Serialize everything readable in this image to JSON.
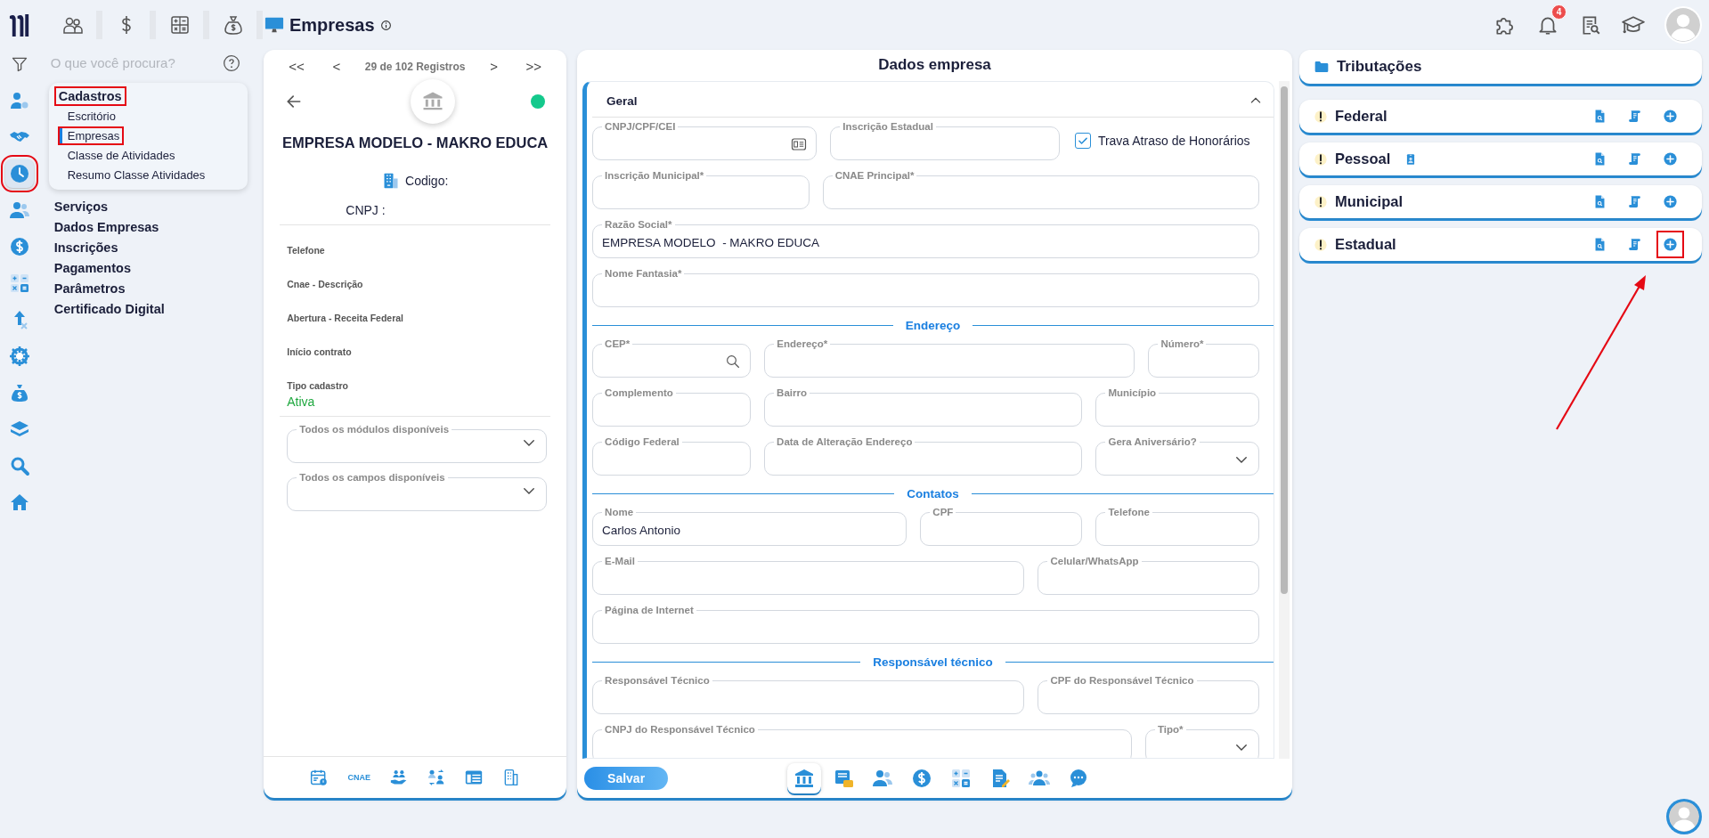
{
  "app_bar": {
    "title": "Empresas",
    "notification_badge": "4"
  },
  "search": {
    "placeholder": "O que você procura?"
  },
  "rail": [
    {
      "selected": false,
      "highlighted": false
    },
    {
      "selected": false,
      "highlighted": false
    },
    {
      "selected": true,
      "highlighted": true
    },
    {
      "selected": false,
      "highlighted": false
    },
    {
      "selected": false,
      "highlighted": false
    },
    {
      "selected": false,
      "highlighted": false
    },
    {
      "selected": false,
      "highlighted": false
    },
    {
      "selected": false,
      "highlighted": false
    },
    {
      "selected": false,
      "highlighted": false
    },
    {
      "selected": false,
      "highlighted": false
    },
    {
      "selected": false,
      "highlighted": false
    },
    {
      "selected": false,
      "highlighted": false
    }
  ],
  "menu": [
    {
      "title": "Cadastros",
      "expanded": true,
      "highlighted": true,
      "children": [
        {
          "label": "Escritório",
          "selected": false,
          "highlighted": false
        },
        {
          "label": "Empresas",
          "selected": true,
          "highlighted": true
        },
        {
          "label": "Classe de Atividades",
          "selected": false,
          "highlighted": false
        },
        {
          "label": "Resumo Classe Atividades",
          "selected": false,
          "highlighted": false
        }
      ]
    },
    {
      "title": "Serviços",
      "expanded": false,
      "highlighted": false
    },
    {
      "title": "Dados Empresas",
      "expanded": false,
      "highlighted": false
    },
    {
      "title": "Inscrições",
      "expanded": false,
      "highlighted": false
    },
    {
      "title": "Pagamentos",
      "expanded": false,
      "highlighted": false
    },
    {
      "title": "Parâmetros",
      "expanded": false,
      "highlighted": false
    },
    {
      "title": "Certificado Digital",
      "expanded": false,
      "highlighted": false
    }
  ],
  "record": {
    "pager": {
      "first": "<<",
      "prev": "<",
      "text": "29 de 102 Registros",
      "next": ">",
      "last": ">>"
    },
    "active": true,
    "name": "EMPRESA MODELO - MAKRO EDUCA",
    "code_label": "Codigo:",
    "cnpj_label": "CNPJ :",
    "info": [
      {
        "label": "Telefone"
      },
      {
        "label": "Cnae - Descrição"
      },
      {
        "label": "Abertura - Receita Federal"
      },
      {
        "label": "Início contrato"
      },
      {
        "label": "Tipo cadastro",
        "value": "Ativa"
      }
    ],
    "selects": [
      {
        "label": "Todos os módulos disponíveis"
      },
      {
        "label": "Todos os campos disponíveis"
      }
    ],
    "footer": [
      {
        "kind": "icon"
      },
      {
        "kind": "text",
        "text": "CNAE"
      },
      {
        "kind": "icon"
      },
      {
        "kind": "icon"
      },
      {
        "kind": "icon"
      },
      {
        "kind": "icon"
      }
    ]
  },
  "form": {
    "title": "Dados empresa",
    "section": {
      "title": "Geral",
      "expanded": true
    },
    "groups": [
      {
        "rows": [
          {
            "fields": [
              {
                "kind": "document",
                "label": "CNPJ/CPF/CEI"
              },
              {
                "kind": "text",
                "label": "Inscrição Estadual"
              },
              {
                "kind": "checkbox",
                "label": "Trava Atraso de Honorários",
                "checked": true
              }
            ]
          },
          {
            "fields": [
              {
                "kind": "text",
                "label": "Inscrição Municipal*"
              },
              {
                "kind": "text",
                "label": "CNAE Principal*"
              }
            ]
          },
          {
            "fields": [
              {
                "kind": "text",
                "label": "Razão Social*",
                "value": "EMPRESA MODELO  - MAKRO EDUCA"
              }
            ]
          },
          {
            "fields": [
              {
                "kind": "text",
                "label": "Nome Fantasia*"
              }
            ]
          }
        ]
      },
      {
        "heading": "Endereço",
        "rows": [
          {
            "fields": [
              {
                "kind": "search",
                "label": "CEP*"
              },
              {
                "kind": "text",
                "label": "Endereço*"
              },
              {
                "kind": "text",
                "label": "Número*"
              }
            ]
          },
          {
            "fields": [
              {
                "kind": "text",
                "label": "Complemento"
              },
              {
                "kind": "text",
                "label": "Bairro"
              },
              {
                "kind": "text",
                "label": "Município"
              }
            ]
          },
          {
            "fields": [
              {
                "kind": "text",
                "label": "Código Federal"
              },
              {
                "kind": "text",
                "label": "Data de Alteração Endereço"
              },
              {
                "kind": "select",
                "label": "Gera Aniversário?"
              }
            ]
          }
        ]
      },
      {
        "heading": "Contatos",
        "rows": [
          {
            "fields": [
              {
                "kind": "text",
                "label": "Nome",
                "value": "Carlos Antonio"
              },
              {
                "kind": "text",
                "label": "CPF"
              },
              {
                "kind": "text",
                "label": "Telefone"
              }
            ]
          },
          {
            "fields": [
              {
                "kind": "text",
                "label": "E-Mail"
              },
              {
                "kind": "text",
                "label": "Celular/WhatsApp"
              }
            ]
          },
          {
            "fields": [
              {
                "kind": "text",
                "label": "Página de Internet"
              }
            ]
          }
        ]
      },
      {
        "heading": "Responsável técnico",
        "rows": [
          {
            "fields": [
              {
                "kind": "text",
                "label": "Responsável Técnico"
              },
              {
                "kind": "text",
                "label": "CPF do Responsável Técnico"
              }
            ]
          },
          {
            "fields": [
              {
                "kind": "text",
                "label": "CNPJ do Responsável Técnico"
              },
              {
                "kind": "select",
                "label": "Tipo*"
              }
            ]
          }
        ]
      }
    ],
    "save": "Salvar",
    "tabs": [
      {
        "selected": true
      },
      {
        "selected": false
      },
      {
        "selected": false
      },
      {
        "selected": false
      },
      {
        "selected": false
      },
      {
        "selected": false
      },
      {
        "selected": false
      },
      {
        "selected": false
      }
    ]
  },
  "taxes": {
    "title": "Tributações",
    "items": [
      {
        "title": "Federal",
        "badge": false,
        "add_highlighted": false
      },
      {
        "title": "Pessoal",
        "badge": true,
        "add_highlighted": false
      },
      {
        "title": "Municipal",
        "badge": false,
        "add_highlighted": false
      },
      {
        "title": "Estadual",
        "badge": false,
        "add_highlighted": true
      }
    ]
  }
}
